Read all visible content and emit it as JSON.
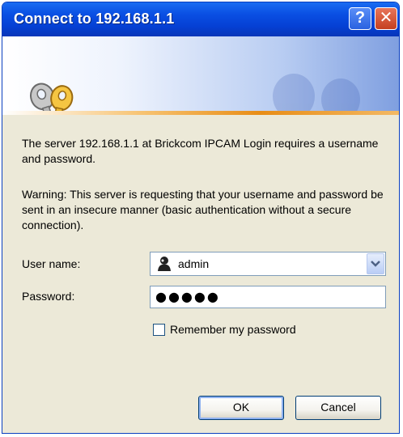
{
  "window": {
    "title": "Connect to 192.168.1.1",
    "help_glyph": "?",
    "close_glyph": "✕"
  },
  "banner": {
    "icon": "keys-icon"
  },
  "message": {
    "line1": "The server 192.168.1.1 at Brickcom IPCAM Login requires a username and password.",
    "line2": "Warning: This server is requesting that your username and password be sent in an insecure manner (basic authentication without a secure connection)."
  },
  "form": {
    "username_label": "User name:",
    "username_value": "admin",
    "password_label": "Password:",
    "password_value": "●●●●●",
    "remember_label": "Remember my password",
    "remember_checked": false
  },
  "buttons": {
    "ok": "OK",
    "cancel": "Cancel"
  },
  "colors": {
    "titlebar": "#0540d4",
    "dialog_bg": "#ece9d8",
    "banner_accent": "#e88d16"
  }
}
